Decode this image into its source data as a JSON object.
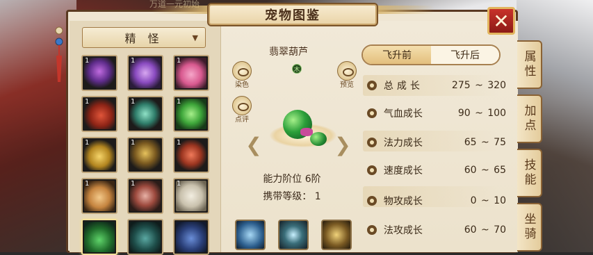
{
  "window": {
    "title": "宠物图鉴",
    "close_label": "✕",
    "background_notice": "万道一元初始"
  },
  "side_tabs": [
    {
      "label": "属性"
    },
    {
      "label": "加点"
    },
    {
      "label": "技能"
    },
    {
      "label": "坐骑"
    }
  ],
  "category": {
    "selected": "精 怪",
    "arrow": "▼"
  },
  "pet_grid": [
    {
      "count": "1",
      "icon": "purple-sword-icon"
    },
    {
      "count": "1",
      "icon": "purple-tiger-icon"
    },
    {
      "count": "1",
      "icon": "pink-deer-icon"
    },
    {
      "count": "1",
      "icon": "red-gourd-icon"
    },
    {
      "count": "1",
      "icon": "jade-sword-icon"
    },
    {
      "count": "1",
      "icon": "green-tiger-icon"
    },
    {
      "count": "1",
      "icon": "golden-gourd-icon"
    },
    {
      "count": "1",
      "icon": "golden-helmet-icon"
    },
    {
      "count": "1",
      "icon": "red-sword-icon"
    },
    {
      "count": "1",
      "icon": "golden-deer-icon"
    },
    {
      "count": "1",
      "icon": "red-tiger-icon"
    },
    {
      "count": "1",
      "icon": "white-cloud-icon"
    },
    {
      "count": "",
      "icon": "green-gourd-icon"
    },
    {
      "count": "",
      "icon": "dark-teal-icon"
    },
    {
      "count": "",
      "icon": "blue-beast-icon"
    }
  ],
  "pet": {
    "name": "翡翠葫芦",
    "element": "木",
    "dye_label": "染色",
    "preview_label": "预览",
    "review_label": "点评",
    "ability_rank": "能力阶位 6阶",
    "carry_level": "携带等级：  1"
  },
  "growth": {
    "tab_before": "飞升前",
    "tab_after": "飞升后",
    "stats": [
      {
        "name": "总成长",
        "range": "275 ~ 320",
        "icon": "growth-icon"
      },
      {
        "name": "气血成长",
        "range": "90 ~ 100",
        "icon": "heart-icon"
      },
      {
        "name": "法力成长",
        "range": "65 ~ 75",
        "icon": "mana-icon"
      },
      {
        "name": "速度成长",
        "range": "60 ~ 65",
        "icon": "speed-icon"
      },
      {
        "name": "物攻成长",
        "range": "0 ~ 10",
        "icon": "attack-icon"
      },
      {
        "name": "法攻成长",
        "range": "60 ~ 70",
        "icon": "magic-attack-icon"
      }
    ]
  },
  "skills": [
    {
      "icon": "skill-blue-icon"
    },
    {
      "icon": "skill-swirl-icon"
    },
    {
      "icon": "skill-gold-icon"
    }
  ]
}
